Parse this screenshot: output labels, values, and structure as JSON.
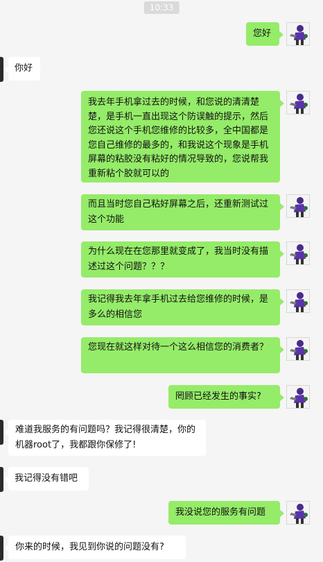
{
  "timestamp": "10:33",
  "messages": [
    {
      "side": "me",
      "text": "您好"
    },
    {
      "side": "other",
      "text": "你好"
    },
    {
      "side": "me",
      "text": "我去年手机拿过去的时候，和您说的清清楚楚，是手机一直出现这个防误触的提示，然后您还说这个手机您维修的比较多，全中国都是您自己维修的最多的，和我说这个现象是手机屏幕的粘胶没有粘好的情况导致的，您说帮我重新粘个胶就可以的"
    },
    {
      "side": "me",
      "text": "而且当时您自己粘好屏幕之后，还重新测试过这个功能"
    },
    {
      "side": "me",
      "text": "为什么现在在您那里就变成了，我当时没有描述过这个问题？？？"
    },
    {
      "side": "me",
      "text": "我记得我去年拿手机过去给您维修的时候，是多么的相信您"
    },
    {
      "side": "me",
      "text": "您现在就这样对待一个这么相信您的消费者？"
    },
    {
      "side": "me",
      "text": "罔顾已经发生的事实?"
    },
    {
      "side": "other",
      "text": "难道我服务的有问题吗？我记得很清楚，你的机器root了，我都跟你保修了!"
    },
    {
      "side": "other",
      "text": "我记得没有错吧"
    },
    {
      "side": "me",
      "text": "我没说您的服务有问题"
    },
    {
      "side": "other",
      "text": "你来的时候，我见到你说的问题没有?"
    }
  ]
}
